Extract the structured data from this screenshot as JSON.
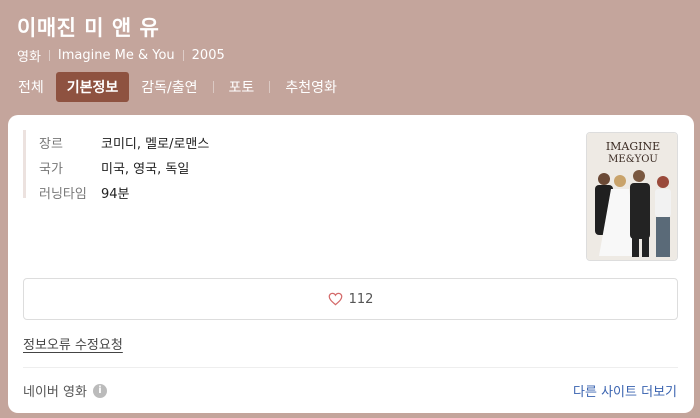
{
  "movie": {
    "title": "이매진 미 앤 유",
    "type": "영화",
    "original_title": "Imagine Me & You",
    "year": "2005"
  },
  "tabs": [
    {
      "label": "전체",
      "active": false
    },
    {
      "label": "기본정보",
      "active": true
    },
    {
      "label": "감독/출연",
      "active": false
    },
    {
      "label": "포토",
      "active": false
    },
    {
      "label": "추천영화",
      "active": false
    }
  ],
  "info": {
    "genre_label": "장르",
    "genre_value": "코미디, 멜로/로맨스",
    "country_label": "국가",
    "country_value": "미국, 영국, 독일",
    "runtime_label": "러닝타임",
    "runtime_value": "94분"
  },
  "poster": {
    "text_line1": "IMAGINE",
    "text_line2": "ME&YOU"
  },
  "like": {
    "count": "112",
    "icon": "heart-outline-icon"
  },
  "links": {
    "report": "정보오류 수정요청",
    "source": "네이버 영화",
    "more": "다른 사이트 더보기"
  },
  "colors": {
    "header_bg": "#c4a59c",
    "active_tab": "#8e5240",
    "link": "#3a63b0",
    "heart": "#d46a6a"
  }
}
